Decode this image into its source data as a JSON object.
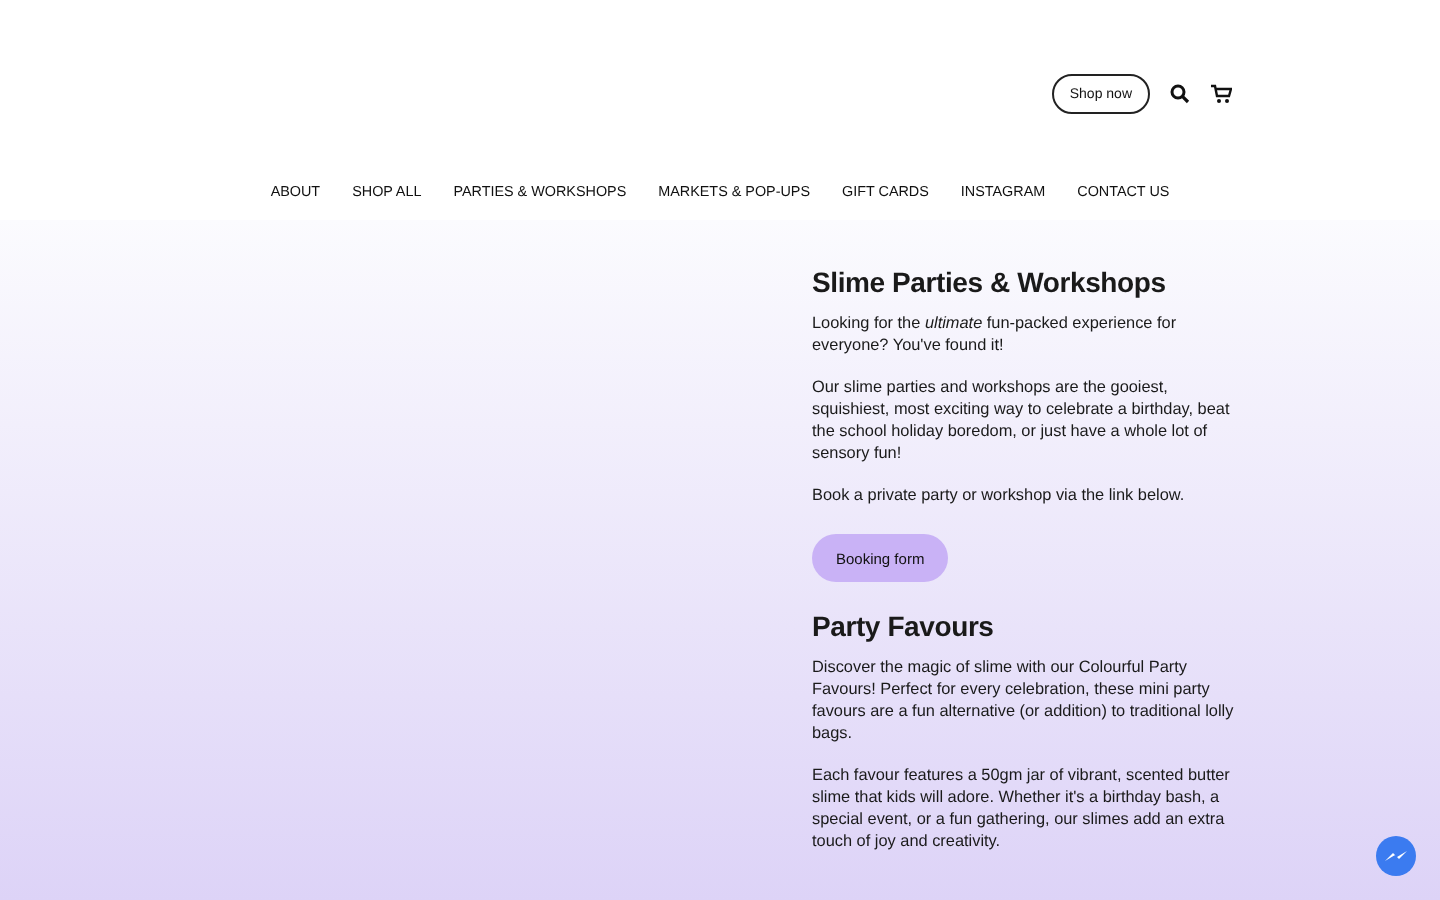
{
  "header": {
    "shop_button": "Shop now"
  },
  "nav": [
    {
      "label": "ABOUT"
    },
    {
      "label": "SHOP ALL"
    },
    {
      "label": "PARTIES & WORKSHOPS"
    },
    {
      "label": "MARKETS & POP-UPS"
    },
    {
      "label": "GIFT CARDS"
    },
    {
      "label": "INSTAGRAM"
    },
    {
      "label": "CONTACT US"
    }
  ],
  "sections": [
    {
      "title": "Slime Parties & Workshops",
      "paragraphs": [
        "Looking for the *ultimate* fun-packed experience for everyone? You've found it!",
        "Our slime parties and workshops are the gooiest, squishiest, most exciting way to celebrate a birthday, beat the school holiday boredom, or just have a whole lot of sensory fun!",
        "Book a private party or workshop via the link below."
      ],
      "button": "Booking form"
    },
    {
      "title": "Party Favours",
      "paragraphs": [
        "Discover the magic of slime with our Colourful Party Favours! Perfect for every celebration, these mini party favours are a fun alternative (or addition) to traditional lolly bags.",
        "Each favour features a 50gm jar of vibrant, scented butter slime that kids will adore. Whether it's a birthday bash, a special event, or a fun gathering, our slimes add an extra touch of joy and creativity."
      ]
    }
  ]
}
